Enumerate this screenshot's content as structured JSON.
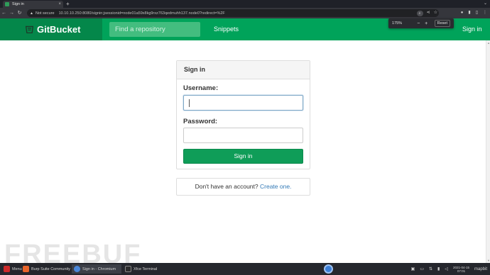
{
  "browser": {
    "tab_title": "Sign in",
    "tab_close": "×",
    "new_tab": "+",
    "security_label": "Not secure",
    "url": "10.10.10.250:8080/signin;jsessionid=node01a59x8kg9rxz763qedmuhh137.node0?redirect=%2F",
    "nav": {
      "back": "←",
      "forward": "→",
      "reload": "↻"
    },
    "icons": [
      "search-icon",
      "share-icon",
      "star-icon",
      "profile-icon",
      "extensions-icon",
      "sidepanel-icon",
      "menu-icon"
    ]
  },
  "zoom_popup": {
    "level": "175%",
    "minus": "−",
    "plus": "+",
    "reset_label": "Reset"
  },
  "header": {
    "brand": "GitBucket",
    "search_placeholder": "Find a repository",
    "snippets_label": "Snippets",
    "signin_label": "Sign in"
  },
  "signin_panel": {
    "title": "Sign in",
    "username_label": "Username:",
    "username_value": "",
    "password_label": "Password:",
    "password_value": "",
    "button_label": "Sign in"
  },
  "account_prompt": {
    "text": "Don't have an account?",
    "link": "Create one."
  },
  "watermark": "FREEBUF",
  "taskbar": {
    "menu_label": "Menu",
    "tasks": [
      {
        "label": "Burp Suite Community ...",
        "color": "#e8652b"
      },
      {
        "label": "Sign in - Chromium",
        "color": "#4a86d8"
      },
      {
        "label": "Xfce Terminal",
        "color": "#2b2b2b"
      }
    ],
    "clock_date": "2021-04-15",
    "clock_time": "07:01",
    "user": "mapbit",
    "colors": {
      "menu_icon": "#cc2a2a",
      "center_app": "#3b7fd8"
    }
  },
  "colors": {
    "header_green": "#00a35a",
    "brand_green": "#04874a",
    "button_green": "#0f9d58",
    "link_blue": "#337ab7"
  }
}
